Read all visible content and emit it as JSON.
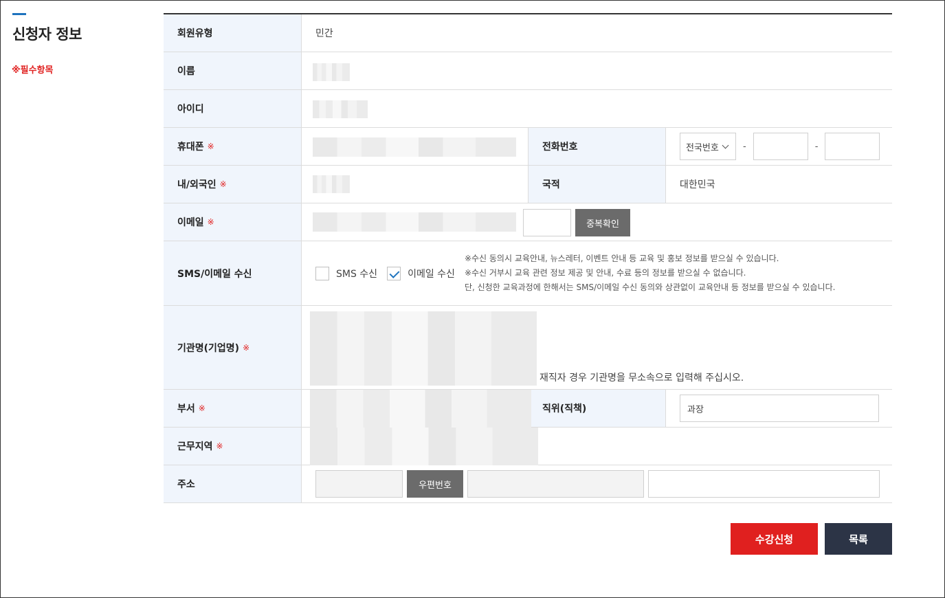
{
  "section": {
    "title": "신청자 정보",
    "required_note": "※필수항목"
  },
  "form": {
    "member_type": {
      "label": "회원유형",
      "value": "민간"
    },
    "name": {
      "label": "이름"
    },
    "user_id": {
      "label": "아이디"
    },
    "mobile": {
      "label": "휴대폰",
      "req": "※"
    },
    "phone": {
      "label": "전화번호",
      "area_select": "전국번호",
      "dash1": "-",
      "dash2": "-"
    },
    "citizenship": {
      "label": "내/외국인",
      "req": "※"
    },
    "nationality": {
      "label": "국적",
      "value": "대한민국"
    },
    "email": {
      "label": "이메일",
      "req": "※",
      "dup_button": "중복확인"
    },
    "sms_email": {
      "label": "SMS/이메일 수신",
      "sms_label": "SMS 수신",
      "sms_checked": false,
      "email_label": "이메일 수신",
      "email_checked": true,
      "notes": [
        "※수신 동의시 교육안내, 뉴스레터, 이벤트 안내 등 교육 및 홍보 정보를 받으실 수 있습니다.",
        "※수신 거부시 교육 관련 정보 제공 및 안내, 수료 등의 정보를 받으실 수 없습니다.",
        "단, 신청한 교육과정에 한해서는 SMS/이메일 수신 동의와 상관없이 교육안내 등 정보를 받으실 수 있습니다."
      ]
    },
    "organization": {
      "label": "기관명(기업명)",
      "req": "※",
      "note": "재직자 경우 기관명을 무소속으로 입력해 주십시오."
    },
    "department": {
      "label": "부서",
      "req": "※"
    },
    "position": {
      "label": "직위(직책)",
      "value": "과장"
    },
    "work_region": {
      "label": "근무지역",
      "req": "※"
    },
    "address": {
      "label": "주소",
      "zip_button": "우편번호"
    }
  },
  "actions": {
    "submit": "수강신청",
    "list": "목록"
  },
  "colors": {
    "accent_red": "#e0201f",
    "navy": "#2c3446",
    "header_bg": "#f0f5fc",
    "blue_bar": "#1e73be"
  }
}
